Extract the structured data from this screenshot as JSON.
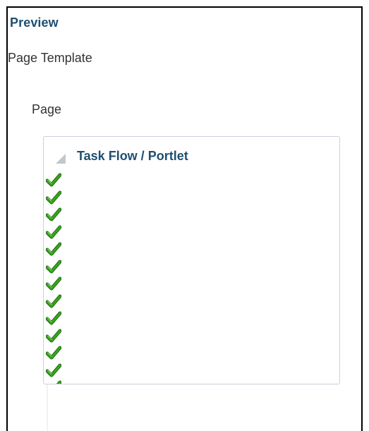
{
  "preview": {
    "title": "Preview"
  },
  "page_template": {
    "label": "Page Template"
  },
  "page": {
    "label": "Page"
  },
  "portlet_panel": {
    "title": "Task Flow / Portlet",
    "disclosure_icon": "collapse-triangle-icon",
    "check_icon": "green-checkmark-icon",
    "check_color": "#3aa31f"
  }
}
